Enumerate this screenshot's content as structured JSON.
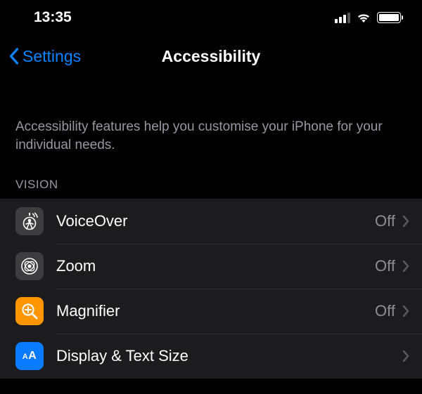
{
  "status": {
    "time": "13:35"
  },
  "nav": {
    "back_label": "Settings",
    "title": "Accessibility"
  },
  "description": "Accessibility features help you customise your iPhone for your individual needs.",
  "section_header": "VISION",
  "items": [
    {
      "label": "VoiceOver",
      "value": "Off",
      "icon": "voiceover"
    },
    {
      "label": "Zoom",
      "value": "Off",
      "icon": "zoom"
    },
    {
      "label": "Magnifier",
      "value": "Off",
      "icon": "magnifier"
    },
    {
      "label": "Display & Text Size",
      "value": "",
      "icon": "display-text"
    }
  ]
}
